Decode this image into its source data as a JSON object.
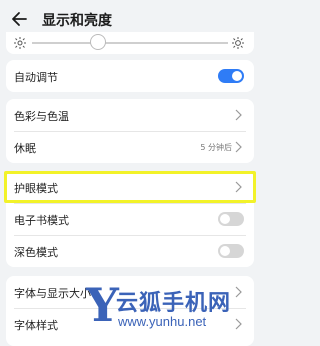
{
  "header": {
    "title": "显示和亮度"
  },
  "brightness": {
    "icons": [
      "sun-low-icon",
      "sun-high-icon"
    ]
  },
  "auto_adjust": {
    "label": "自动调节",
    "on": true
  },
  "rows": {
    "color": "色彩与色温",
    "sleep": "休眠",
    "sleep_value": "5 分钟后",
    "eye": "护眼模式",
    "ebook": "电子书模式",
    "dark": "深色模式",
    "font_size": "字体与显示大小",
    "font_style": "字体样式"
  },
  "watermark": {
    "cn": "云狐手机网",
    "url": "www.yunhu.net"
  },
  "colors": {
    "accent": "#2f7cf6",
    "highlight": "#f2f229",
    "watermark": "#3b63b8"
  }
}
